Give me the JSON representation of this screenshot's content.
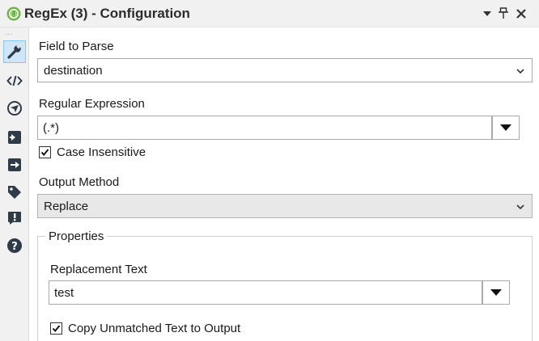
{
  "window": {
    "title": "RegEx (3) - Configuration"
  },
  "fields": {
    "field_to_parse_label": "Field to Parse",
    "field_to_parse_value": "destination",
    "regex_label": "Regular Expression",
    "regex_value": "(.*)",
    "case_insensitive_label": "Case Insensitive",
    "case_insensitive_checked": true,
    "output_method_label": "Output Method",
    "output_method_value": "Replace"
  },
  "properties": {
    "legend": "Properties",
    "replacement_text_label": "Replacement Text",
    "replacement_text_value": "test",
    "copy_unmatched_label": "Copy Unmatched Text to Output",
    "copy_unmatched_checked": true
  },
  "sidebar_icons": [
    "wrench-icon",
    "code-icon",
    "navigate-icon",
    "input-arrow-icon",
    "output-arrow-icon",
    "tag-icon",
    "alert-icon",
    "help-icon"
  ],
  "colors": {
    "accent": "#1f6fa8",
    "icon_dark": "#2f3b46",
    "active_tab": "#cfe6f8",
    "title_icon": "#6fb544"
  }
}
